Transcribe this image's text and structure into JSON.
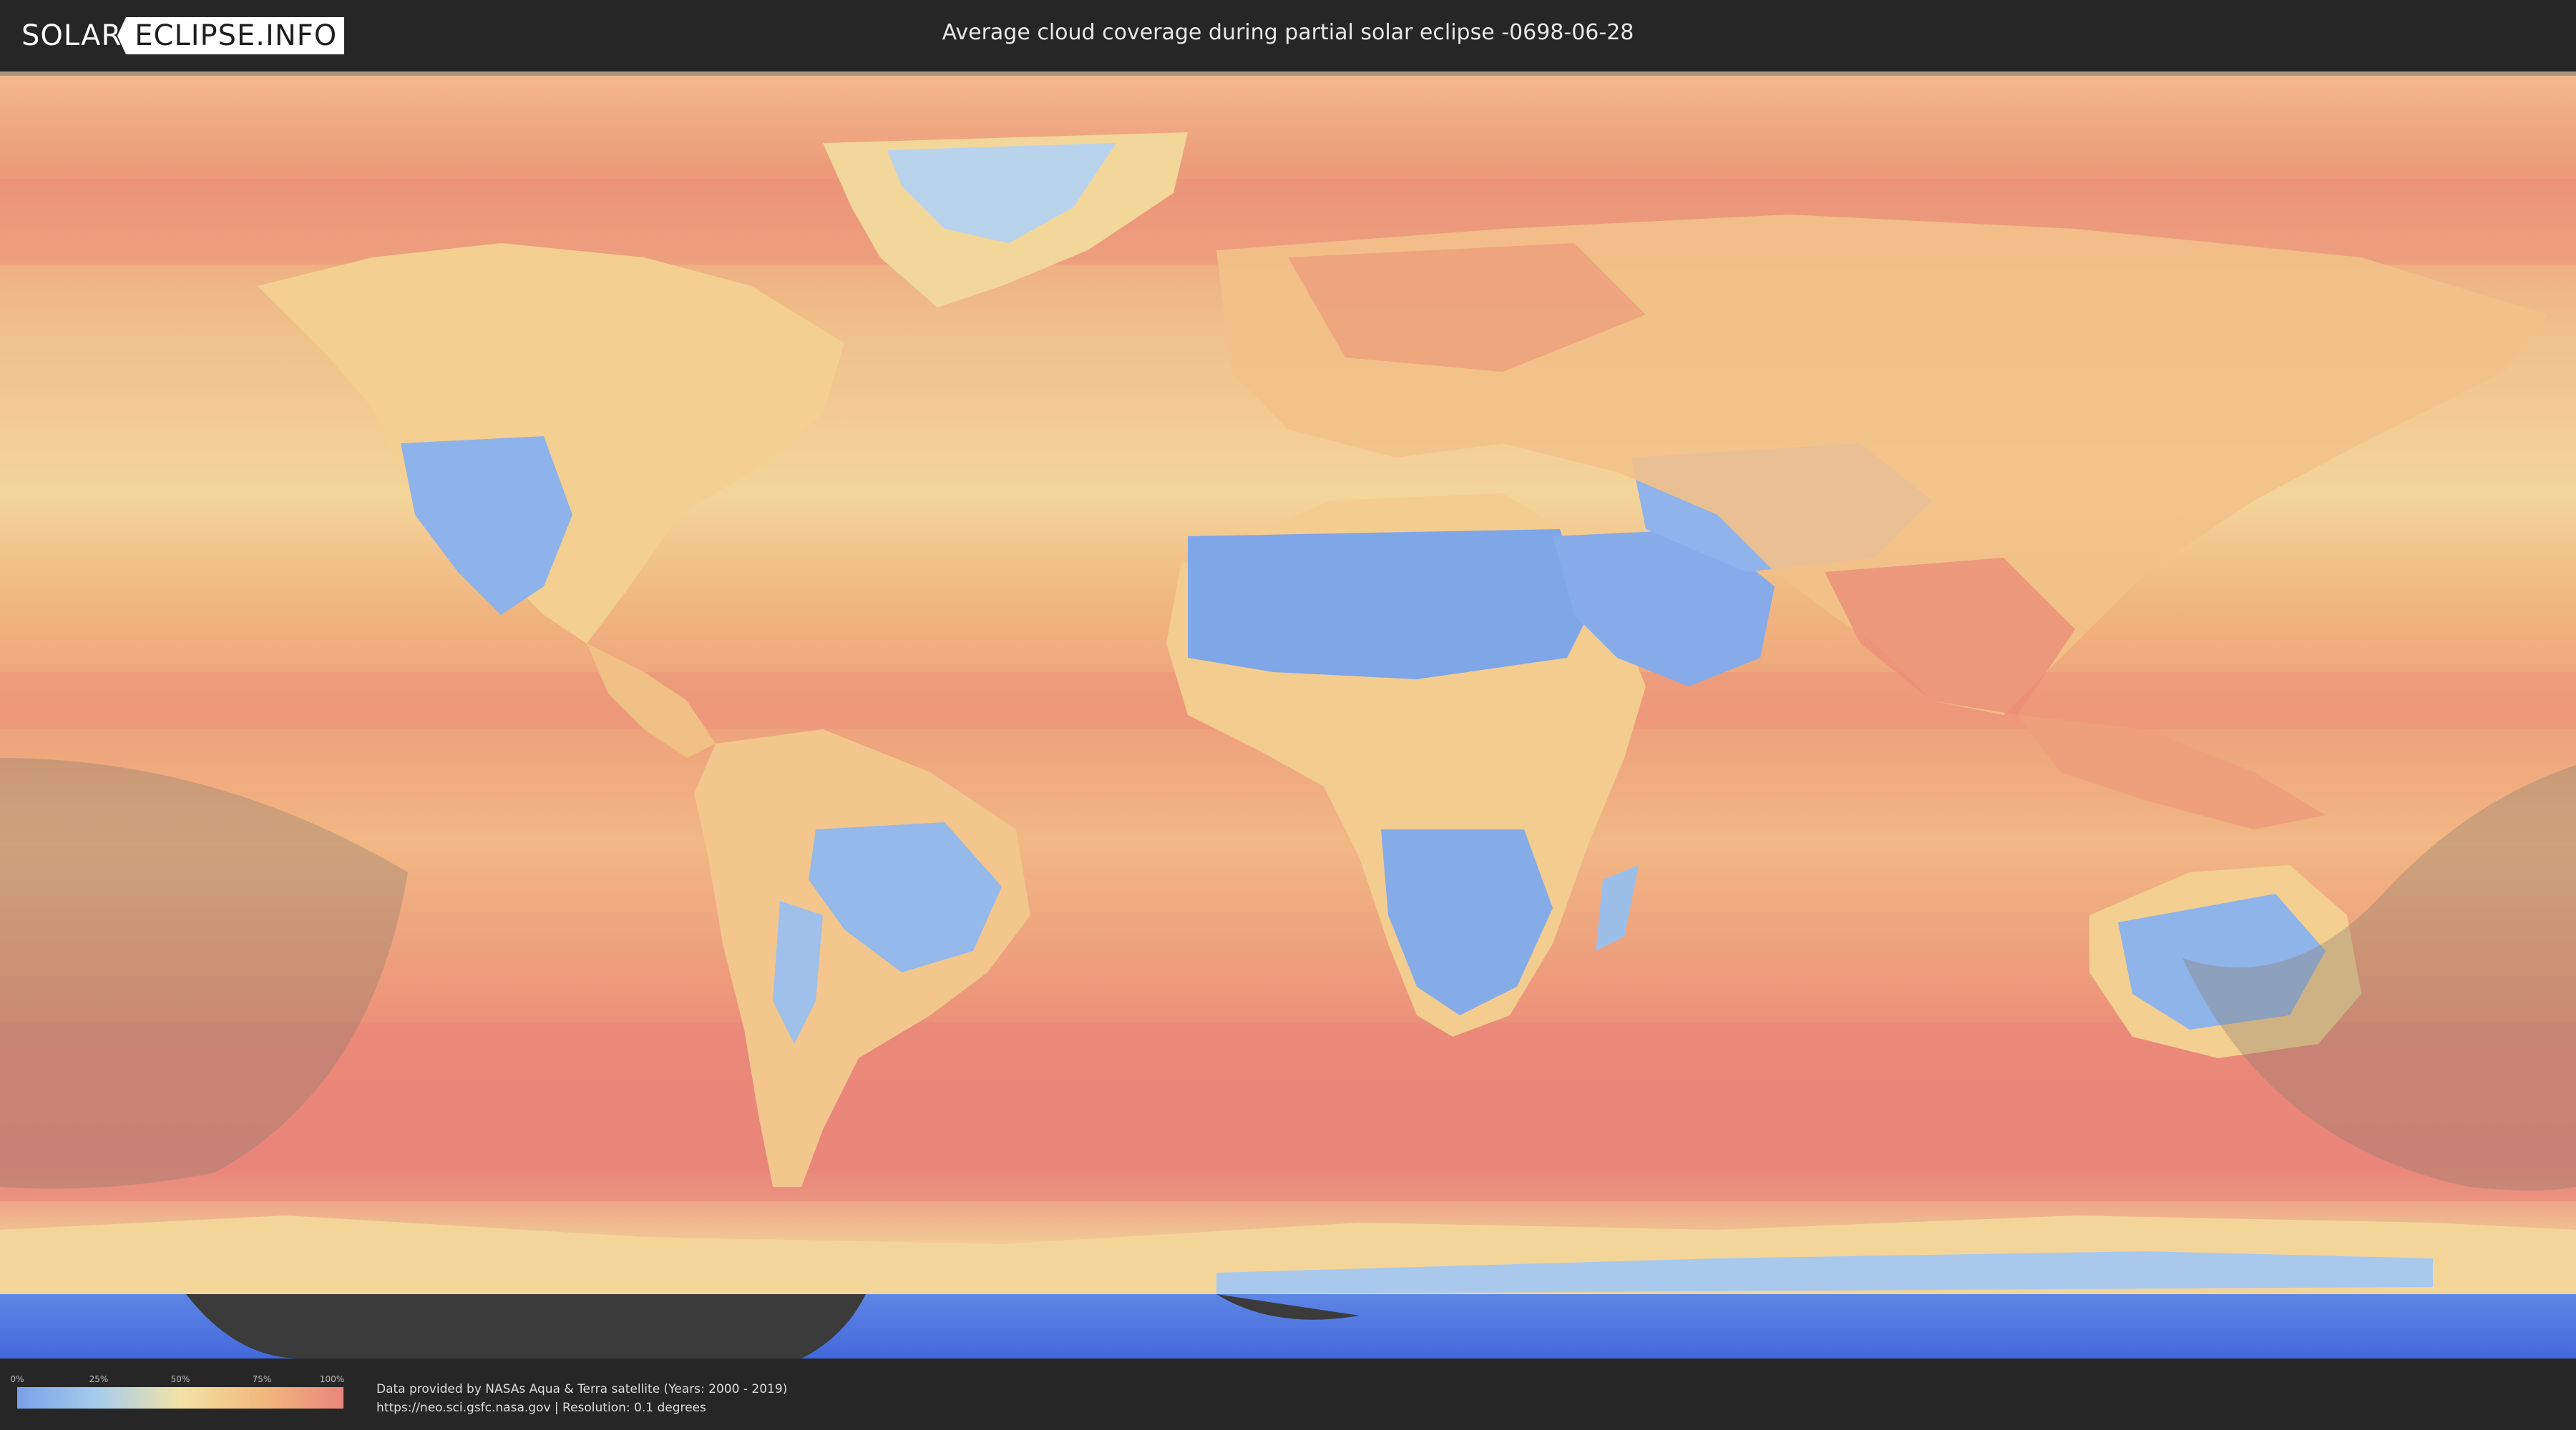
{
  "header": {
    "logo_left": "SOLAR",
    "logo_right": "ECLIPSE.INFO",
    "title": "Average cloud coverage during partial solar eclipse -0698-06-28"
  },
  "map": {
    "type": "world cloud coverage map",
    "projection": "equirectangular",
    "overlay": "partial eclipse visibility zones (shaded)",
    "colors": {
      "low_cloud": "#7aa1e8",
      "mid_cloud": "#f3e2a5",
      "high_cloud": "#e9857c",
      "eclipse_shade": "#8a7a6a",
      "polar_unknown": "#4a72e0"
    }
  },
  "legend": {
    "ticks": [
      "0%",
      "25%",
      "50%",
      "75%",
      "100%"
    ],
    "tick_values": [
      0,
      25,
      50,
      75,
      100
    ]
  },
  "footer": {
    "credit_line1": "Data provided by NASAs Aqua & Terra satellite (Years: 2000 - 2019)",
    "credit_line2": "https://neo.sci.gsfc.nasa.gov | Resolution: 0.1 degrees"
  }
}
